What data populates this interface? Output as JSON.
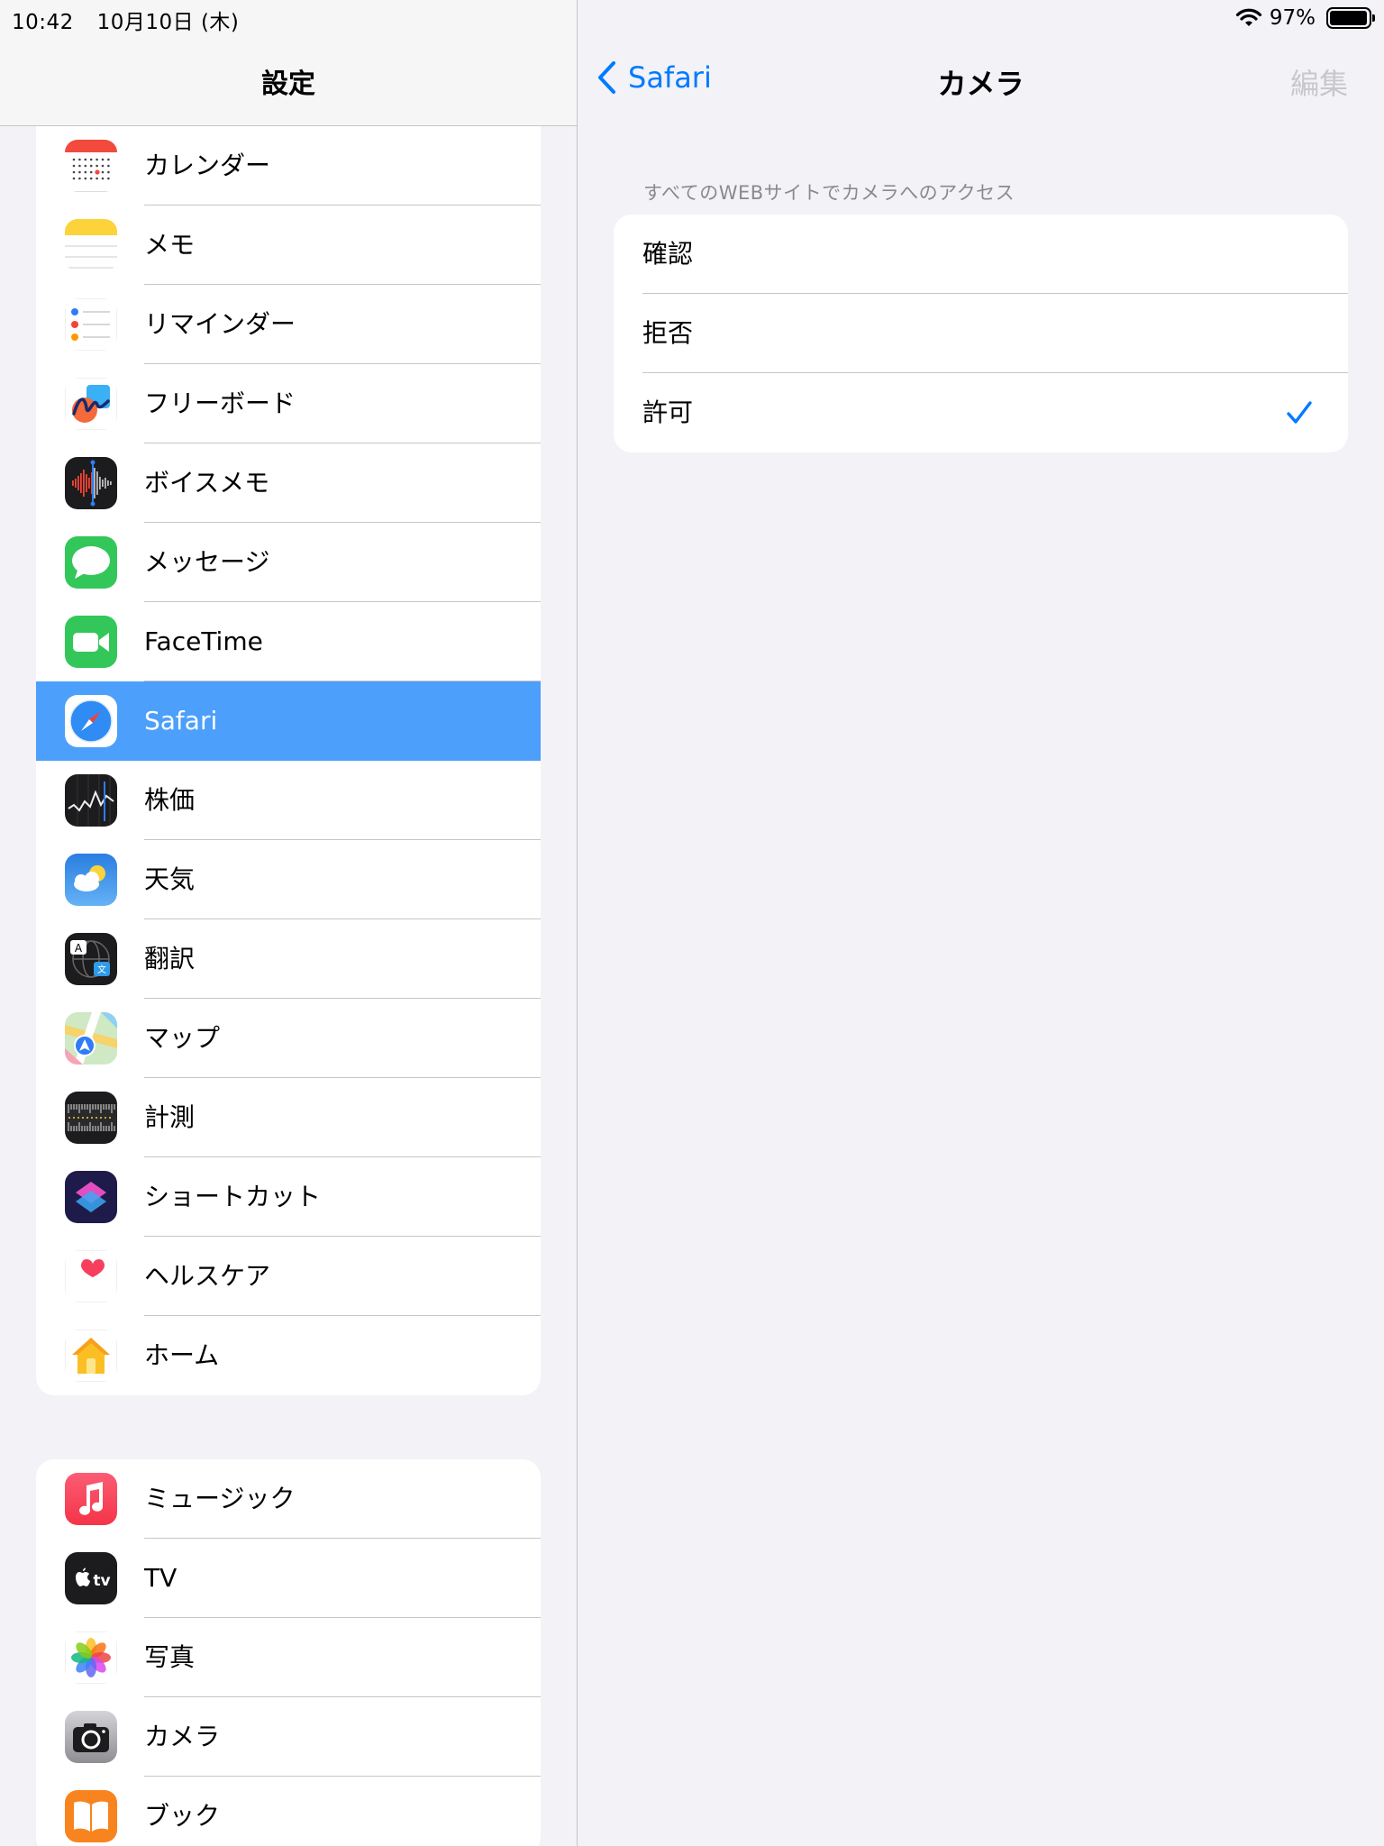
{
  "status_bar": {
    "time": "10:42",
    "date": "10月10日 (木)",
    "battery": "97%",
    "battery_level": 0.97
  },
  "left_pane": {
    "title": "設定",
    "groups": [
      {
        "items": [
          {
            "label": "カレンダー",
            "icon": "calendar-icon"
          },
          {
            "label": "メモ",
            "icon": "notes-icon"
          },
          {
            "label": "リマインダー",
            "icon": "reminders-icon"
          },
          {
            "label": "フリーボード",
            "icon": "freeform-icon"
          },
          {
            "label": "ボイスメモ",
            "icon": "voice-memos-icon"
          },
          {
            "label": "メッセージ",
            "icon": "messages-icon"
          },
          {
            "label": "FaceTime",
            "icon": "facetime-icon"
          },
          {
            "label": "Safari",
            "icon": "safari-icon",
            "selected": true
          },
          {
            "label": "株価",
            "icon": "stocks-icon"
          },
          {
            "label": "天気",
            "icon": "weather-icon"
          },
          {
            "label": "翻訳",
            "icon": "translate-icon"
          },
          {
            "label": "マップ",
            "icon": "maps-icon"
          },
          {
            "label": "計測",
            "icon": "measure-icon"
          },
          {
            "label": "ショートカット",
            "icon": "shortcuts-icon"
          },
          {
            "label": "ヘルスケア",
            "icon": "health-icon"
          },
          {
            "label": "ホーム",
            "icon": "home-icon"
          }
        ]
      },
      {
        "items": [
          {
            "label": "ミュージック",
            "icon": "music-icon"
          },
          {
            "label": "TV",
            "icon": "tv-icon"
          },
          {
            "label": "写真",
            "icon": "photos-icon"
          },
          {
            "label": "カメラ",
            "icon": "camera-icon"
          },
          {
            "label": "ブック",
            "icon": "books-icon"
          }
        ]
      }
    ]
  },
  "right_pane": {
    "back_label": "Safari",
    "title": "カメラ",
    "edit_label": "編集",
    "section_header": "すべてのWEBサイトでカメラへのアクセス",
    "options": [
      {
        "label": "確認",
        "checked": false
      },
      {
        "label": "拒否",
        "checked": false
      },
      {
        "label": "許可",
        "checked": true
      }
    ]
  },
  "colors": {
    "accent": "#007aff",
    "selected_row": "#4c9ffa",
    "background": "#f2f2f7"
  }
}
